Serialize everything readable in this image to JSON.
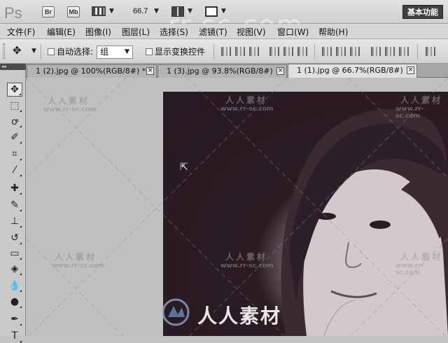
{
  "app": {
    "logo": "Ps",
    "bridge": "Br",
    "minibridge": "Mb",
    "zoom": "66.7",
    "workspace": "基本功能"
  },
  "menu": [
    "文件(F)",
    "编辑(E)",
    "图像(I)",
    "图层(L)",
    "选择(S)",
    "滤镜(T)",
    "视图(V)",
    "窗口(W)",
    "帮助(H)"
  ],
  "options": {
    "auto_select_label": "自动选择:",
    "auto_select_value": "组",
    "transform_label": "显示变换控件"
  },
  "tabs": [
    {
      "label": "1 (2).jpg @ 100%(RGB/8#) *"
    },
    {
      "label": "1 (3).jpg @ 93.8%(RGB/8#)"
    },
    {
      "label": "1 (1).jpg @ 66.7%(RGB/8#)"
    }
  ],
  "tab_close": "×",
  "toolbar_header": "◂◂",
  "tools": [
    {
      "name": "move-tool-icon",
      "glyph": "✥"
    },
    {
      "name": "marquee-tool-icon",
      "glyph": "⬚"
    },
    {
      "name": "lasso-tool-icon",
      "glyph": "ꝍ"
    },
    {
      "name": "quick-select-tool-icon",
      "glyph": "✐"
    },
    {
      "name": "crop-tool-icon",
      "glyph": "⌗"
    },
    {
      "name": "eyedropper-tool-icon",
      "glyph": "⁄"
    },
    {
      "name": "healing-brush-tool-icon",
      "glyph": "✚"
    },
    {
      "name": "brush-tool-icon",
      "glyph": "✎"
    },
    {
      "name": "clone-stamp-tool-icon",
      "glyph": "⊥"
    },
    {
      "name": "history-brush-tool-icon",
      "glyph": "↺"
    },
    {
      "name": "eraser-tool-icon",
      "glyph": "▭"
    },
    {
      "name": "paint-bucket-tool-icon",
      "glyph": "◈"
    },
    {
      "name": "blur-tool-icon",
      "glyph": "💧"
    },
    {
      "name": "dodge-tool-icon",
      "glyph": "●"
    },
    {
      "name": "pen-tool-icon",
      "glyph": "✒"
    },
    {
      "name": "type-tool-icon",
      "glyph": "T"
    }
  ],
  "watermark": {
    "brand": "人人素材",
    "url": "www.rr-sc.com",
    "large": "rr-sc.com",
    "logo_text": "人人素材"
  }
}
